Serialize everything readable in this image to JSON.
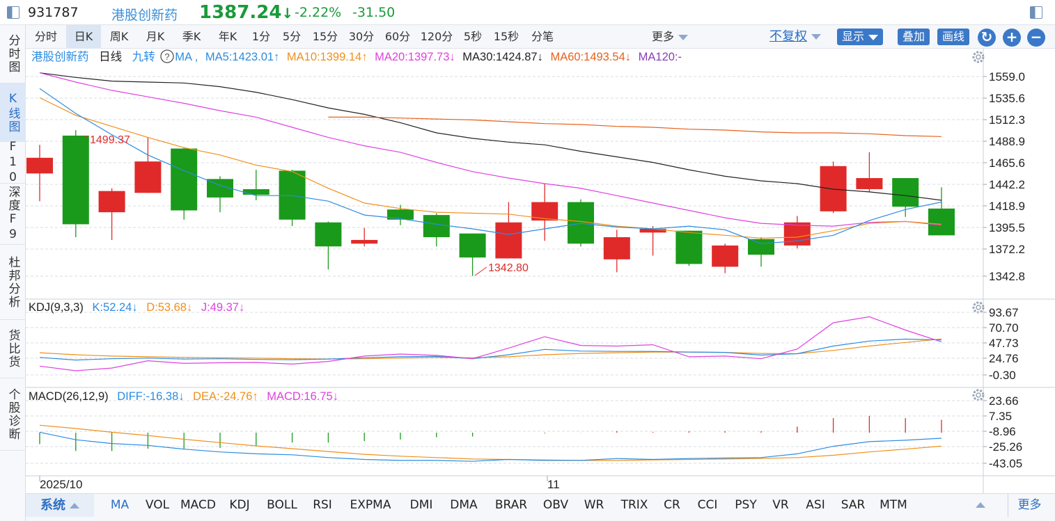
{
  "titlebar": {
    "code": "931787",
    "name": "港股创新药",
    "price": "1387.24",
    "price_arrow": "↓",
    "change_pct": "-2.22%",
    "change": "-31.50"
  },
  "leftnav": [
    {
      "label": "分时图"
    },
    {
      "label": "K线图"
    },
    {
      "label": "F10"
    },
    {
      "label": "深度F9"
    },
    {
      "label": "杜邦分析"
    },
    {
      "label": "货比货"
    },
    {
      "label": "个股诊断"
    }
  ],
  "toolbar": {
    "timeframes": [
      "分时",
      "日K",
      "周K",
      "月K",
      "季K",
      "年K",
      "1分",
      "5分",
      "15分",
      "30分",
      "60分",
      "120分",
      "5秒",
      "15秒",
      "分笔"
    ],
    "active_timeframe": "日K",
    "more": "更多",
    "adjust": "不复权",
    "display": "显示",
    "overlay": "叠加",
    "draw": "画线"
  },
  "main_legend": {
    "name": "港股创新药",
    "period": "日线",
    "turn": "九转",
    "help": "?",
    "ma": "MA ,",
    "items": [
      {
        "text": "MA5:1423.01↑",
        "color": "#2b8ce0"
      },
      {
        "text": "MA10:1399.14↑",
        "color": "#f0901a"
      },
      {
        "text": "MA20:1397.73↓",
        "color": "#e040e0"
      },
      {
        "text": "MA30:1424.87↓",
        "color": "#222222"
      },
      {
        "text": "MA60:1493.54↓",
        "color": "#e8601a"
      },
      {
        "text": "MA120:-",
        "color": "#8a3fb8"
      }
    ]
  },
  "price_axis": [
    "1559.0",
    "1535.6",
    "1512.3",
    "1488.9",
    "1465.6",
    "1442.2",
    "1418.9",
    "1395.5",
    "1372.2",
    "1342.8"
  ],
  "annotations": {
    "high": "1499.37",
    "low": "1342.80"
  },
  "kdj_legend": {
    "name": "KDJ(9,3,3)",
    "items": [
      {
        "text": "K:52.24↓",
        "color": "#2b8ce0"
      },
      {
        "text": "D:53.68↓",
        "color": "#f0901a"
      },
      {
        "text": "J:49.37↓",
        "color": "#e040e0"
      }
    ]
  },
  "kdj_axis": [
    "93.67",
    "70.70",
    "47.73",
    "24.76",
    "-0.30"
  ],
  "macd_legend": {
    "name": "MACD(26,12,9)",
    "items": [
      {
        "text": "DIFF:-16.38↓",
        "color": "#2b8ce0"
      },
      {
        "text": "DEA:-24.76↑",
        "color": "#f0901a"
      },
      {
        "text": "MACD:16.75↓",
        "color": "#e040e0"
      }
    ]
  },
  "macd_axis": [
    "23.66",
    "7.35",
    "-8.96",
    "-25.26",
    "-43.05"
  ],
  "date_axis": [
    "2025/10",
    "11"
  ],
  "chart_data": {
    "type": "candlestick",
    "colors": {
      "up": "#e02a2a",
      "down": "#1a9a1a"
    },
    "candles": [
      {
        "o": 1454,
        "c": 1471,
        "h": 1485,
        "l": 1424
      },
      {
        "o": 1495,
        "c": 1399,
        "h": 1501,
        "l": 1385
      },
      {
        "o": 1412,
        "c": 1435,
        "h": 1438,
        "l": 1382
      },
      {
        "o": 1433,
        "c": 1467,
        "h": 1493,
        "l": 1433
      },
      {
        "o": 1481,
        "c": 1414,
        "h": 1482,
        "l": 1404
      },
      {
        "o": 1448,
        "c": 1428,
        "h": 1451,
        "l": 1412
      },
      {
        "o": 1437,
        "c": 1431,
        "h": 1458,
        "l": 1425
      },
      {
        "o": 1457,
        "c": 1404,
        "h": 1458,
        "l": 1397
      },
      {
        "o": 1401,
        "c": 1375,
        "h": 1402,
        "l": 1350
      },
      {
        "o": 1378,
        "c": 1382,
        "h": 1395,
        "l": 1375
      },
      {
        "o": 1415,
        "c": 1404,
        "h": 1420,
        "l": 1398
      },
      {
        "o": 1409,
        "c": 1385,
        "h": 1411,
        "l": 1375
      },
      {
        "o": 1389,
        "c": 1363,
        "h": 1389,
        "l": 1343
      },
      {
        "o": 1362,
        "c": 1401,
        "h": 1423,
        "l": 1362
      },
      {
        "o": 1403,
        "c": 1423,
        "h": 1443,
        "l": 1381
      },
      {
        "o": 1423,
        "c": 1378,
        "h": 1426,
        "l": 1375
      },
      {
        "o": 1361,
        "c": 1385,
        "h": 1393,
        "l": 1347
      },
      {
        "o": 1390,
        "c": 1394,
        "h": 1397,
        "l": 1365
      },
      {
        "o": 1392,
        "c": 1356,
        "h": 1392,
        "l": 1354
      },
      {
        "o": 1353,
        "c": 1376,
        "h": 1378,
        "l": 1346
      },
      {
        "o": 1383,
        "c": 1366,
        "h": 1385,
        "l": 1353
      },
      {
        "o": 1376,
        "c": 1401,
        "h": 1408,
        "l": 1373
      },
      {
        "o": 1413,
        "c": 1462,
        "h": 1467,
        "l": 1411
      },
      {
        "o": 1437,
        "c": 1449,
        "h": 1477,
        "l": 1434
      },
      {
        "o": 1449,
        "c": 1418,
        "h": 1449,
        "l": 1407
      },
      {
        "o": 1416,
        "c": 1387,
        "h": 1439,
        "l": 1387
      }
    ],
    "ma": {
      "ma5": [
        1546,
        1519,
        1496,
        1474,
        1457,
        1441,
        1430,
        1430,
        1424,
        1409,
        1405,
        1399,
        1394,
        1388,
        1394,
        1400,
        1396,
        1394,
        1397,
        1393,
        1378,
        1381,
        1387,
        1403,
        1415,
        1423
      ],
      "ma10": [
        1536,
        1517,
        1505,
        1493,
        1482,
        1474,
        1463,
        1456,
        1438,
        1422,
        1416,
        1412,
        1411,
        1410,
        1405,
        1402,
        1397,
        1394,
        1390,
        1387,
        1384,
        1385,
        1392,
        1400,
        1402,
        1399
      ],
      "ma20": [
        1563,
        1553,
        1544,
        1537,
        1530,
        1522,
        1515,
        1504,
        1493,
        1484,
        1477,
        1466,
        1456,
        1449,
        1443,
        1438,
        1430,
        1422,
        1414,
        1406,
        1400,
        1398,
        1397,
        1401,
        1402,
        1398
      ],
      "ma30": [
        1563,
        1558,
        1554,
        1553,
        1552,
        1548,
        1542,
        1534,
        1525,
        1518,
        1509,
        1498,
        1492,
        1488,
        1485,
        1478,
        1472,
        1466,
        1458,
        1451,
        1446,
        1443,
        1437,
        1434,
        1430,
        1425
      ],
      "ma60": [
        null,
        null,
        null,
        null,
        null,
        null,
        null,
        null,
        1515,
        1515,
        1514,
        1513,
        1512,
        1510,
        1508,
        1507,
        1505,
        1504,
        1502,
        1501,
        1499,
        1498,
        1498,
        1497,
        1495,
        1494
      ]
    },
    "kdj": {
      "K": [
        26.0,
        22.0,
        24.0,
        25.0,
        23.5,
        24.0,
        23.0,
        22.5,
        23.5,
        25.5,
        27.0,
        27.5,
        24.0,
        30.0,
        38.0,
        35.5,
        35.0,
        35.0,
        34.0,
        33.5,
        29.5,
        31.5,
        43.0,
        50.5,
        53.5,
        52.2
      ],
      "D": [
        33.0,
        30.0,
        28.0,
        27.0,
        26.0,
        25.5,
        25.0,
        24.0,
        23.5,
        24.0,
        25.0,
        26.0,
        25.5,
        27.0,
        30.0,
        32.0,
        33.0,
        34.0,
        34.0,
        33.5,
        32.0,
        31.5,
        36.5,
        43.0,
        48.5,
        53.7
      ],
      "J": [
        13.0,
        6.0,
        10.0,
        21.0,
        17.0,
        18.0,
        18.5,
        16.0,
        20.0,
        28.0,
        31.0,
        29.0,
        24.0,
        40.0,
        57.0,
        44.0,
        43.0,
        45.0,
        27.0,
        28.0,
        24.0,
        38.5,
        78.0,
        87.0,
        67.0,
        49.4
      ]
    },
    "macd": {
      "DIFF": [
        -10.0,
        -18.0,
        -22.0,
        -24.0,
        -28.0,
        -31.0,
        -33.0,
        -34.0,
        -37.0,
        -39.0,
        -40.0,
        -40.0,
        -41.0,
        -39.0,
        -40.0,
        -40.0,
        -38.0,
        -39.0,
        -38.0,
        -37.5,
        -37.0,
        -33.0,
        -25.0,
        -20.0,
        -18.5,
        -16.4
      ],
      "DEA": [
        -2.5,
        -6.0,
        -10.0,
        -13.5,
        -17.5,
        -21.0,
        -24.5,
        -27.5,
        -30.5,
        -33.5,
        -35.5,
        -37.0,
        -38.5,
        -39.0,
        -39.5,
        -40.0,
        -40.0,
        -39.5,
        -39.0,
        -38.5,
        -38.0,
        -37.0,
        -34.5,
        -31.0,
        -28.0,
        -24.8
      ],
      "MACD": [
        -15.0,
        -24.0,
        -24.0,
        -21.0,
        -21.0,
        -20.0,
        -17.0,
        -13.0,
        -13.0,
        -11.0,
        -9.0,
        -6.0,
        -5.0,
        0.0,
        -1.0,
        -0.2,
        2.0,
        1.0,
        2.0,
        2.0,
        2.0,
        8.0,
        19.0,
        22.0,
        19.0,
        16.8
      ]
    }
  },
  "bottombar": {
    "system": "系统",
    "indicators": [
      "MA",
      "VOL",
      "MACD",
      "KDJ",
      "BOLL",
      "RSI",
      "EXPMA",
      "DMI",
      "DMA",
      "BRAR",
      "OBV",
      "WR",
      "TRIX",
      "CR",
      "CCI",
      "PSY",
      "VR",
      "ASI",
      "SAR",
      "MTM"
    ],
    "active": "MA",
    "more": "更多"
  }
}
